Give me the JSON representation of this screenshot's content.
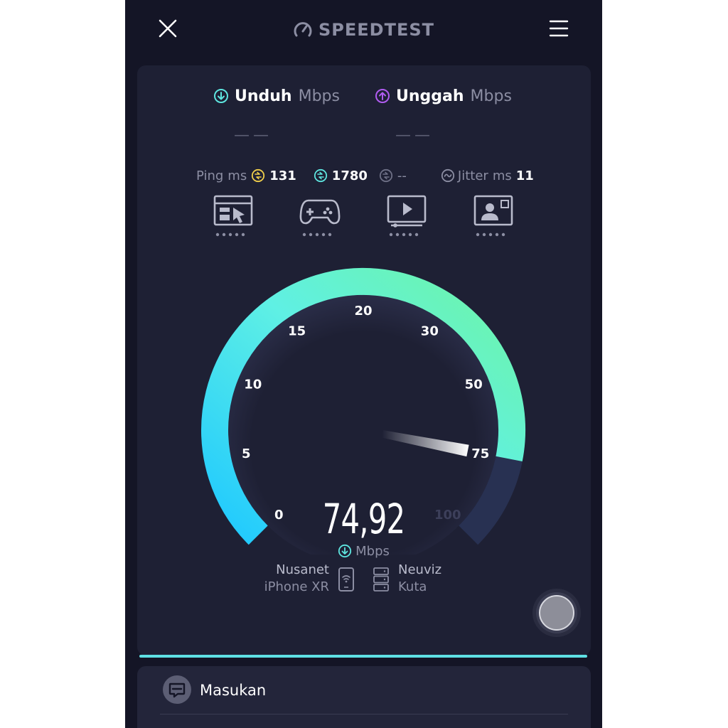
{
  "header": {
    "logo_text": "SPEEDTEST",
    "close_icon": "close-icon",
    "menu_icon": "hamburger-menu-icon"
  },
  "download": {
    "label": "Unduh",
    "unit": "Mbps",
    "value": "— —",
    "icon": "download-arrow-icon"
  },
  "upload": {
    "label": "Unggah",
    "unit": "Mbps",
    "value": "— —",
    "icon": "upload-arrow-icon"
  },
  "ping": {
    "label": "Ping",
    "unit": "ms",
    "idle": "131",
    "download": "1780",
    "upload": "--",
    "jitter_label": "Jitter",
    "jitter_unit": "ms",
    "jitter": "11"
  },
  "app_icons": [
    {
      "name": "web-browsing-icon"
    },
    {
      "name": "gaming-icon"
    },
    {
      "name": "video-streaming-icon"
    },
    {
      "name": "video-call-icon"
    }
  ],
  "gauge": {
    "ticks": [
      "0",
      "5",
      "10",
      "15",
      "20",
      "30",
      "50",
      "75",
      "100"
    ],
    "value": 74.92,
    "max": 100
  },
  "result": {
    "value": "74,92",
    "unit": "Mbps"
  },
  "provider": {
    "name": "Nusanet",
    "device": "iPhone XR"
  },
  "server": {
    "name": "Neuviz",
    "location": "Kuta"
  },
  "feedback": {
    "label": "Masukan"
  },
  "colors": {
    "background": "#141526",
    "card": "#1e2034",
    "accent_cyan": "#5fe0e4",
    "download_icon": "#5ee6e0",
    "upload_icon": "#b05cf0",
    "ping_idle_icon": "#f2d04b",
    "gauge_start": "#1ec8ff",
    "gauge_end": "#6ef5a6"
  }
}
